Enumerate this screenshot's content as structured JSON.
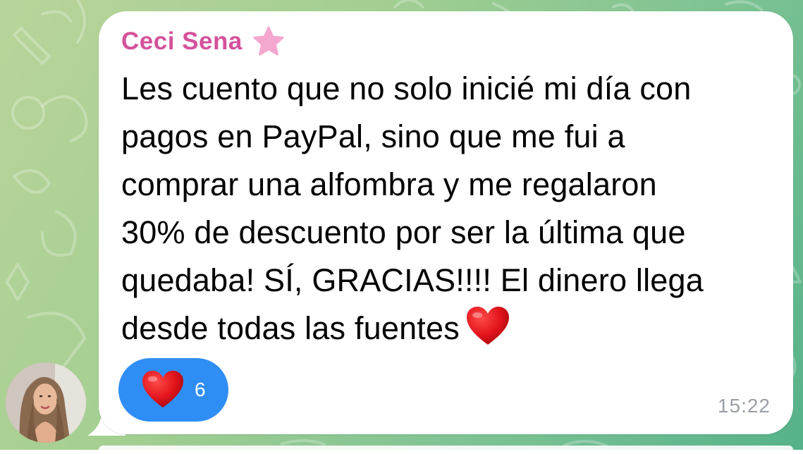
{
  "message": {
    "sender_name": "Ceci Sena",
    "sender_badge_icon": "star-icon",
    "text": "Les cuento que no solo inicié mi día con\npagos en PayPal, sino que me fui a\ncomprar una alfombra y me regalaron\n30% de descuento por ser la última que\nquedaba! SÍ, GRACIAS!!!! El dinero llega\ndesde todas las fuentes",
    "text_trailing_emoji": "heart-emoji",
    "timestamp": "15:22"
  },
  "reaction": {
    "emoji": "heart-emoji",
    "count": "6"
  },
  "colors": {
    "sender_name": "#d4529b",
    "reaction_pill": "#2f8ef5",
    "bubble": "#ffffff",
    "timestamp": "#9aa0a6",
    "background_start": "#b9d49a",
    "background_end": "#56b28a"
  }
}
